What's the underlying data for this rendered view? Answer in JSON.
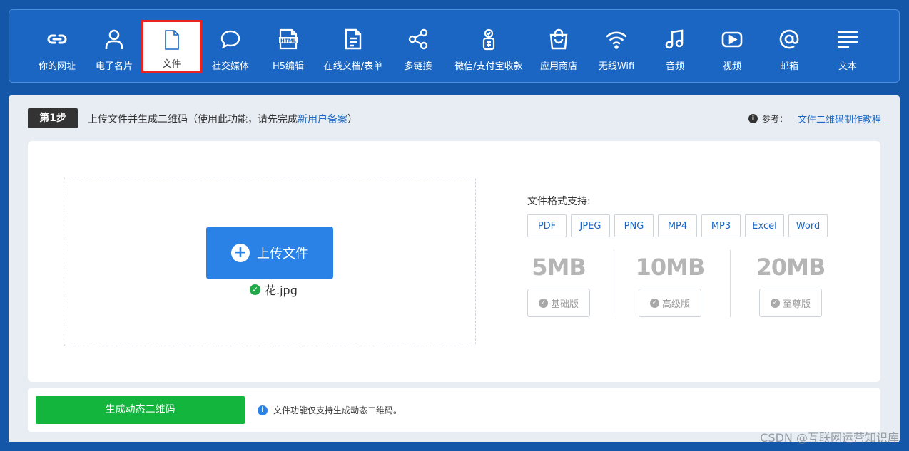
{
  "nav": {
    "items": [
      {
        "label": "你的网址",
        "icon": "link-icon"
      },
      {
        "label": "电子名片",
        "icon": "person-icon"
      },
      {
        "label": "文件",
        "icon": "file-icon",
        "active": true
      },
      {
        "label": "社交媒体",
        "icon": "chat-bubble-icon"
      },
      {
        "label": "H5编辑",
        "icon": "html-icon"
      },
      {
        "label": "在线文档/表单",
        "icon": "document-icon"
      },
      {
        "label": "多链接",
        "icon": "share-icon"
      },
      {
        "label": "微信/支付宝收款",
        "icon": "payment-icon"
      },
      {
        "label": "应用商店",
        "icon": "shopping-bag-icon"
      },
      {
        "label": "无线Wifi",
        "icon": "wifi-icon"
      },
      {
        "label": "音频",
        "icon": "music-icon"
      },
      {
        "label": "视频",
        "icon": "video-play-icon"
      },
      {
        "label": "邮箱",
        "icon": "at-icon"
      },
      {
        "label": "文本",
        "icon": "text-lines-icon"
      }
    ]
  },
  "step": {
    "badge": "第1步",
    "text_prefix": "上传文件并生成二维码（使用此功能，请先完成",
    "link": "新用户备案",
    "text_suffix": "）",
    "ref_label": "参考：",
    "ref_link": "文件二维码制作教程"
  },
  "upload": {
    "button_label": "上传文件",
    "filename": "花.jpg"
  },
  "formats": {
    "title": "文件格式支持:",
    "items": [
      "PDF",
      "JPEG",
      "PNG",
      "MP4",
      "MP3",
      "Excel",
      "Word"
    ]
  },
  "tiers": [
    {
      "size": "5MB",
      "label": "基础版"
    },
    {
      "size": "10MB",
      "label": "高级版"
    },
    {
      "size": "20MB",
      "label": "至尊版"
    }
  ],
  "generate": {
    "button_label": "生成动态二维码",
    "note": "文件功能仅支持生成动态二维码。"
  },
  "watermark": "CSDN @互联网运营知识库",
  "colors": {
    "background": "#1457a8",
    "nav_bg": "#1a66c2",
    "accent_blue": "#2b82e6",
    "generate_green": "#13b53d",
    "highlight_red": "#e82420"
  }
}
